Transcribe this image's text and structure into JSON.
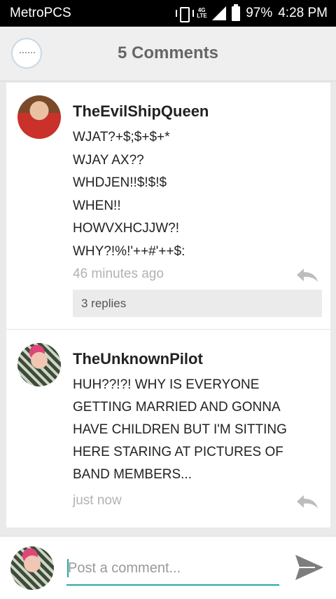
{
  "status_bar": {
    "carrier": "MetroPCS",
    "network": "4G LTE",
    "battery": "97%",
    "time": "4:28 PM"
  },
  "header": {
    "title": "5 Comments"
  },
  "comments": [
    {
      "username": "TheEvilShipQueen",
      "text": "WJAT?+$;$+$+*\nWJAY AX??\nWHDJEN!!$!$!$\nWHEN!!\nHOWVXHCJJW?!\nWHY?!%!'++#'++$:",
      "time": "46 minutes ago",
      "replies": "3 replies"
    },
    {
      "username": "TheUnknownPilot",
      "text": "HUH??!?! WHY IS EVERYONE\nGETTING MARRIED AND GONNA\nHAVE CHILDREN BUT I'M SITTING\nHERE STARING AT PICTURES OF\nBAND MEMBERS...",
      "time": "just now"
    }
  ],
  "composer": {
    "placeholder": "Post a comment..."
  },
  "colors": {
    "accent": "#27a7a4",
    "status_bar": "#000000",
    "header_bg": "#efefef",
    "reply_icon": "#bdbdbd",
    "send_icon": "#7d7d7d"
  },
  "icons": {
    "reply": "reply-arrow-icon",
    "send": "send-paper-plane-icon",
    "signal": "cell-signal-icon",
    "battery": "battery-icon",
    "vibrate": "vibrate-icon"
  }
}
